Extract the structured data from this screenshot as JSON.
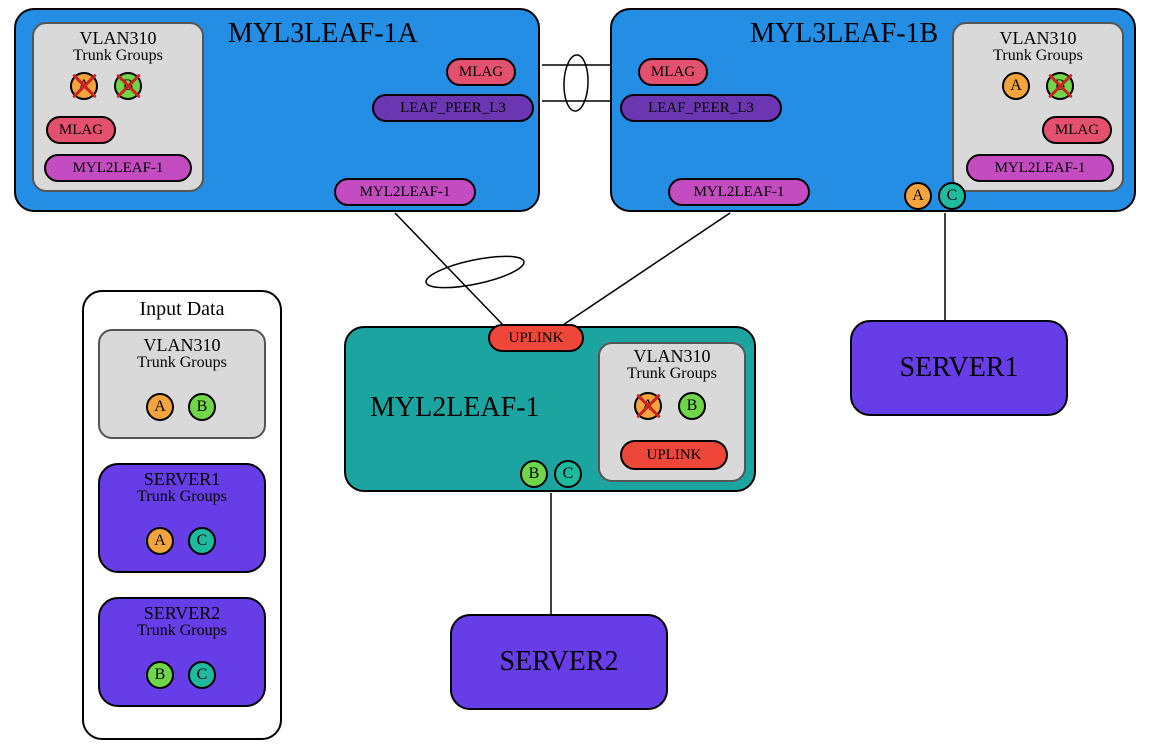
{
  "leaf1a": {
    "title": "MYL3LEAF-1A"
  },
  "leaf1b": {
    "title": "MYL3LEAF-1B"
  },
  "l2leaf": {
    "title": "MYL2LEAF-1"
  },
  "server1": {
    "title": "SERVER1"
  },
  "server2": {
    "title": "SERVER2"
  },
  "vlan_panel": {
    "title": "VLAN310",
    "sub": "Trunk Groups"
  },
  "pills": {
    "mlag": "MLAG",
    "leaf_peer": "LEAF_PEER_L3",
    "myl2leaf": "MYL2LEAF-1",
    "uplink": "UPLINK",
    "A": "A",
    "B": "B",
    "C": "C"
  },
  "input_data": {
    "title": "Input Data",
    "vlan": {
      "title": "VLAN310",
      "sub": "Trunk Groups"
    },
    "srv1": {
      "title": "SERVER1",
      "sub": "Trunk Groups"
    },
    "srv2": {
      "title": "SERVER2",
      "sub": "Trunk Groups"
    }
  },
  "colors": {
    "blue": "#238EE4",
    "teal_node": "#1CA4A0",
    "purple": "#663DE6",
    "gray": "#d9d9d9",
    "pink": "#E3516F",
    "indigo": "#6C36B2",
    "magenta": "#C34CC0",
    "red": "#EE4739",
    "orange": "#F3A43C",
    "green": "#6FD64A",
    "teal_pill": "#1FB99E"
  }
}
